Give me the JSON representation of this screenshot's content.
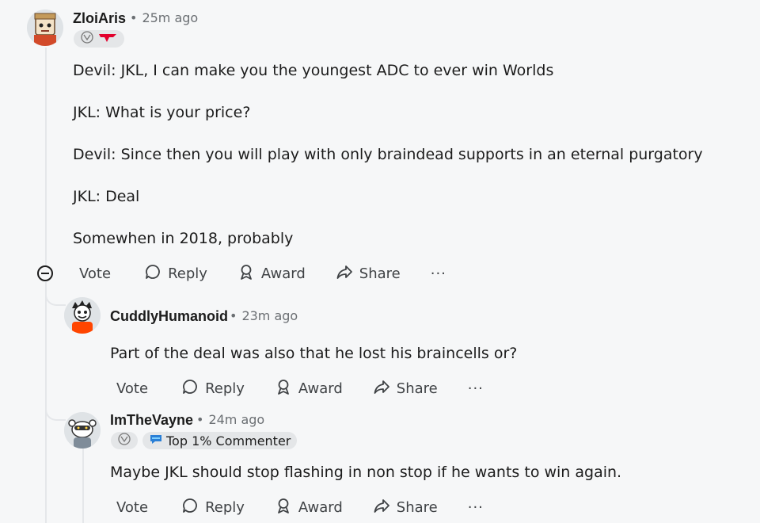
{
  "comments": [
    {
      "username": "ZloiAris",
      "time": "25m ago",
      "paragraphs": [
        "Devil: JKL, I can make you the youngest ADC to ever win Worlds",
        "JKL: What is your price?",
        "Devil: Since then you will play with only braindead supports in an eternal purgatory",
        "JKL: Deal",
        "Somewhen in 2018, probably"
      ]
    },
    {
      "username": "CuddlyHumanoid",
      "time": "23m ago",
      "paragraphs": [
        "Part of the deal was also that he lost his braincells or?"
      ]
    },
    {
      "username": "ImTheVayne",
      "time": "24m ago",
      "flair": "Top 1% Commenter",
      "paragraphs": [
        "Maybe JKL should stop flashing in non stop if he wants to win again."
      ]
    }
  ],
  "actions": {
    "vote": "Vote",
    "reply": "Reply",
    "award": "Award",
    "share": "Share",
    "more": "···"
  },
  "colors": {
    "background": "#f6f7f8",
    "text": "#1c1c1c",
    "muted": "#6b6f73",
    "flair_bg": "#e4e6e8",
    "thread_line": "#e5e7ea"
  }
}
